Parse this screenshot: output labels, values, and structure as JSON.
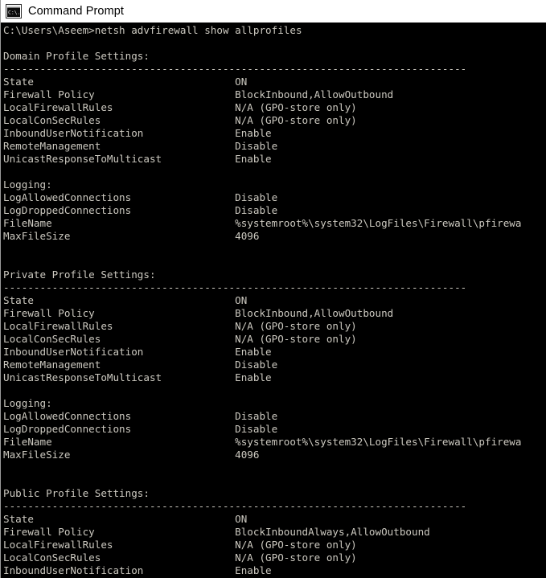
{
  "window": {
    "title": "Command Prompt",
    "icon": "command-prompt-icon",
    "titlebar_bg": "#ffffff",
    "console_bg": "#000000",
    "console_fg": "#ccc9c0"
  },
  "terminal": {
    "prompt_path": "C:\\Users\\Aseem>",
    "command": "netsh advfirewall show allprofiles",
    "prompt_line": "C:\\Users\\Aseem>netsh advfirewall show allprofiles",
    "separator": "----------------------------------------------------------------------",
    "value_column": 41,
    "lines": [
      "C:\\Users\\Aseem>netsh advfirewall show allprofiles",
      "",
      "Domain Profile Settings:",
      "----------------------------------------------------------------------------",
      "State                                 ON",
      "Firewall Policy                       BlockInbound,AllowOutbound",
      "LocalFirewallRules                    N/A (GPO-store only)",
      "LocalConSecRules                      N/A (GPO-store only)",
      "InboundUserNotification               Enable",
      "RemoteManagement                      Disable",
      "UnicastResponseToMulticast            Enable",
      "",
      "Logging:",
      "LogAllowedConnections                 Disable",
      "LogDroppedConnections                 Disable",
      "FileName                              %systemroot%\\system32\\LogFiles\\Firewall\\pfirewa",
      "MaxFileSize                           4096",
      "",
      "",
      "Private Profile Settings:",
      "----------------------------------------------------------------------------",
      "State                                 ON",
      "Firewall Policy                       BlockInbound,AllowOutbound",
      "LocalFirewallRules                    N/A (GPO-store only)",
      "LocalConSecRules                      N/A (GPO-store only)",
      "InboundUserNotification               Enable",
      "RemoteManagement                      Disable",
      "UnicastResponseToMulticast            Enable",
      "",
      "Logging:",
      "LogAllowedConnections                 Disable",
      "LogDroppedConnections                 Disable",
      "FileName                              %systemroot%\\system32\\LogFiles\\Firewall\\pfirewa",
      "MaxFileSize                           4096",
      "",
      "",
      "Public Profile Settings:",
      "----------------------------------------------------------------------------",
      "State                                 ON",
      "Firewall Policy                       BlockInboundAlways,AllowOutbound",
      "LocalFirewallRules                    N/A (GPO-store only)",
      "LocalConSecRules                      N/A (GPO-store only)",
      "InboundUserNotification               Enable"
    ],
    "profiles": [
      {
        "heading": "Domain Profile Settings:",
        "settings": [
          {
            "key": "State",
            "value": "ON"
          },
          {
            "key": "Firewall Policy",
            "value": "BlockInbound,AllowOutbound"
          },
          {
            "key": "LocalFirewallRules",
            "value": "N/A (GPO-store only)"
          },
          {
            "key": "LocalConSecRules",
            "value": "N/A (GPO-store only)"
          },
          {
            "key": "InboundUserNotification",
            "value": "Enable"
          },
          {
            "key": "RemoteManagement",
            "value": "Disable"
          },
          {
            "key": "UnicastResponseToMulticast",
            "value": "Enable"
          }
        ],
        "logging_heading": "Logging:",
        "logging": [
          {
            "key": "LogAllowedConnections",
            "value": "Disable"
          },
          {
            "key": "LogDroppedConnections",
            "value": "Disable"
          },
          {
            "key": "FileName",
            "value": "%systemroot%\\system32\\LogFiles\\Firewall\\pfirewa"
          },
          {
            "key": "MaxFileSize",
            "value": "4096"
          }
        ]
      },
      {
        "heading": "Private Profile Settings:",
        "settings": [
          {
            "key": "State",
            "value": "ON"
          },
          {
            "key": "Firewall Policy",
            "value": "BlockInbound,AllowOutbound"
          },
          {
            "key": "LocalFirewallRules",
            "value": "N/A (GPO-store only)"
          },
          {
            "key": "LocalConSecRules",
            "value": "N/A (GPO-store only)"
          },
          {
            "key": "InboundUserNotification",
            "value": "Enable"
          },
          {
            "key": "RemoteManagement",
            "value": "Disable"
          },
          {
            "key": "UnicastResponseToMulticast",
            "value": "Enable"
          }
        ],
        "logging_heading": "Logging:",
        "logging": [
          {
            "key": "LogAllowedConnections",
            "value": "Disable"
          },
          {
            "key": "LogDroppedConnections",
            "value": "Disable"
          },
          {
            "key": "FileName",
            "value": "%systemroot%\\system32\\LogFiles\\Firewall\\pfirewa"
          },
          {
            "key": "MaxFileSize",
            "value": "4096"
          }
        ]
      },
      {
        "heading": "Public Profile Settings:",
        "settings": [
          {
            "key": "State",
            "value": "ON"
          },
          {
            "key": "Firewall Policy",
            "value": "BlockInboundAlways,AllowOutbound"
          },
          {
            "key": "LocalFirewallRules",
            "value": "N/A (GPO-store only)"
          },
          {
            "key": "LocalConSecRules",
            "value": "N/A (GPO-store only)"
          },
          {
            "key": "InboundUserNotification",
            "value": "Enable"
          }
        ],
        "logging_heading": "",
        "logging": []
      }
    ]
  }
}
